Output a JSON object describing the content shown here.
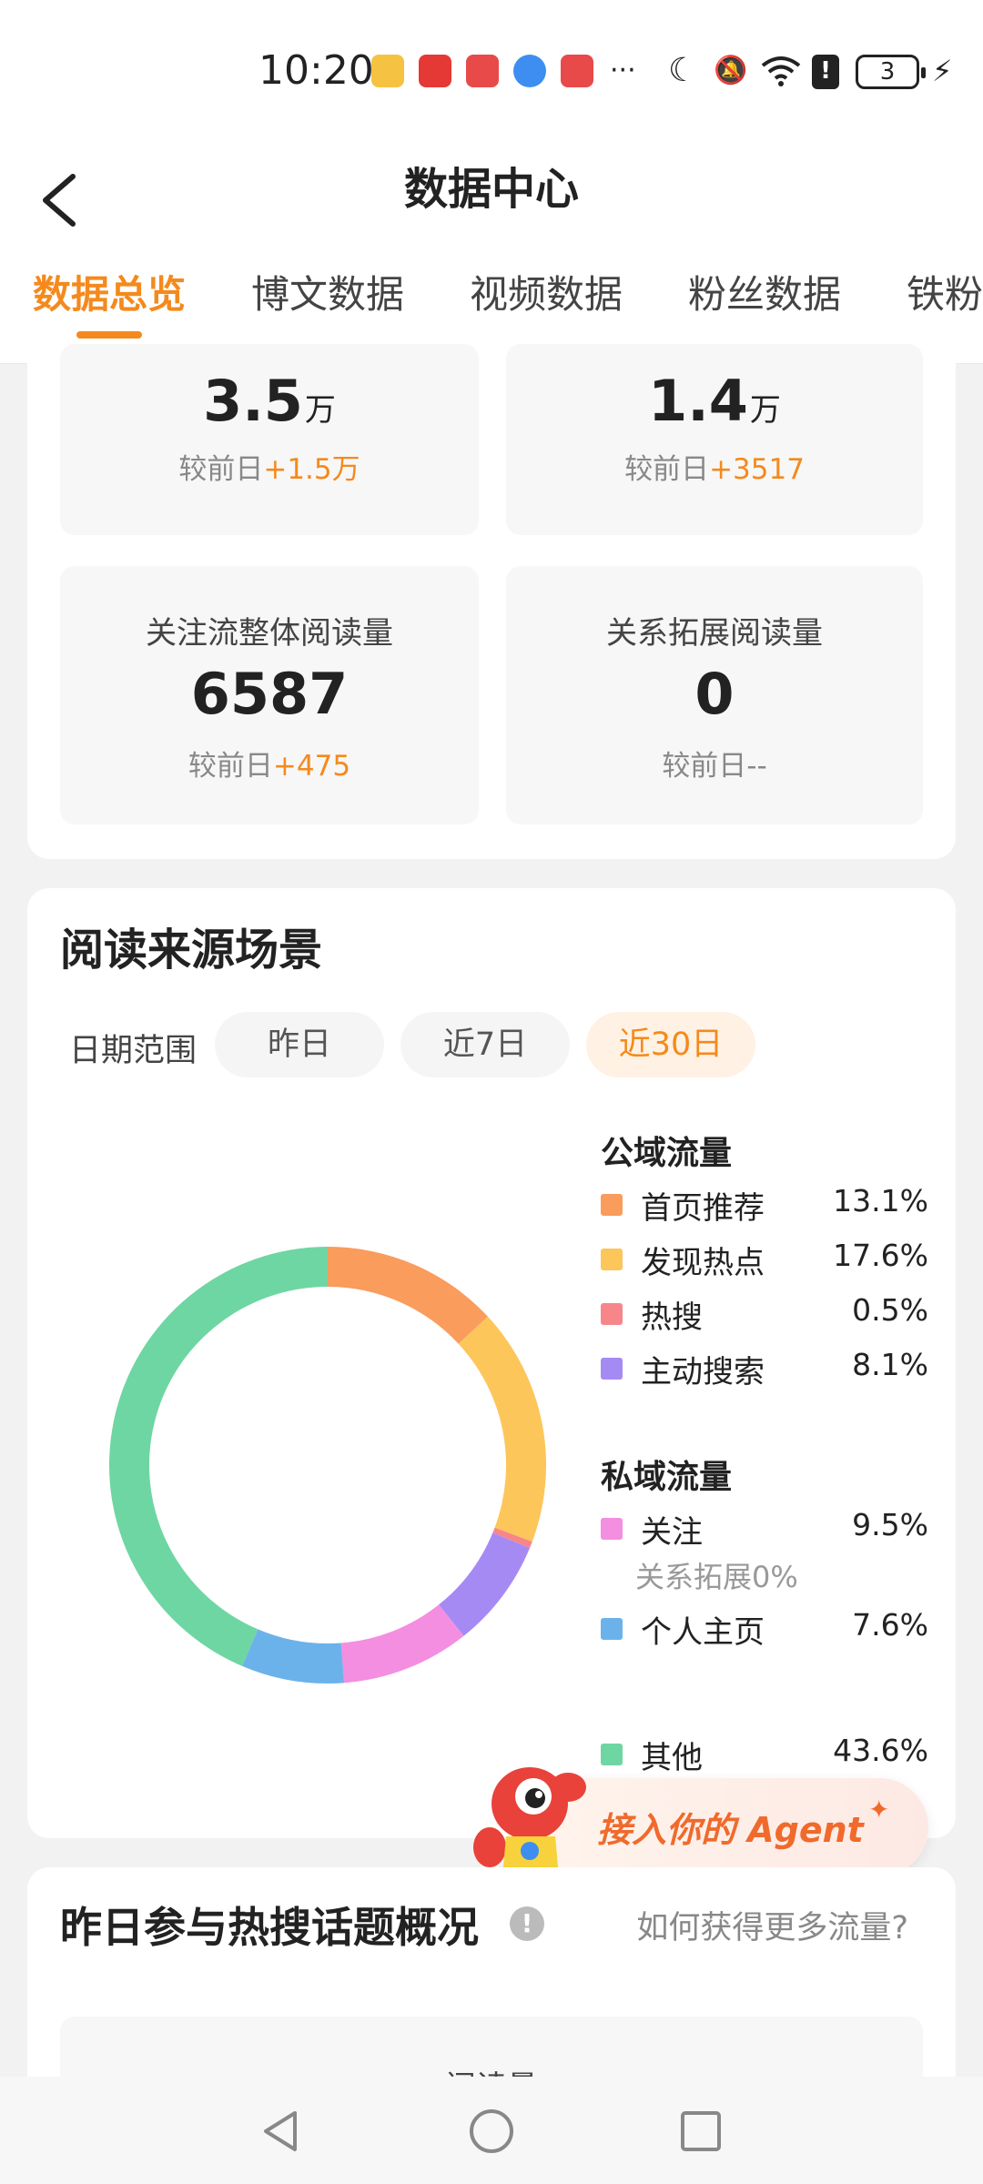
{
  "status_bar": {
    "time": "10:20",
    "battery": "3",
    "notification_apps": [
      "weibo-app-icon",
      "xiaohongshu-app-icon",
      "reader-app-icon",
      "browser-app-icon",
      "reader-app-icon"
    ],
    "more_indicator": "···"
  },
  "header": {
    "title": "数据中心",
    "tabs": [
      {
        "label": "数据总览",
        "active": true
      },
      {
        "label": "博文数据",
        "active": false
      },
      {
        "label": "视频数据",
        "active": false
      },
      {
        "label": "粉丝数据",
        "active": false
      },
      {
        "label": "铁粉",
        "active": false
      }
    ]
  },
  "overview": {
    "stats": [
      {
        "label": "",
        "value": "3.5",
        "unit": "万",
        "delta_prefix": "较前日",
        "delta": "+1.5万"
      },
      {
        "label": "",
        "value": "1.4",
        "unit": "万",
        "delta_prefix": "较前日",
        "delta": "+3517"
      },
      {
        "label": "关注流整体阅读量",
        "value": "6587",
        "unit": "",
        "delta_prefix": "较前日",
        "delta": "+475"
      },
      {
        "label": "关系拓展阅读量",
        "value": "0",
        "unit": "",
        "delta_prefix": "较前日",
        "delta": "--"
      }
    ]
  },
  "read_sources": {
    "title": "阅读来源场景",
    "date_range_label": "日期范围",
    "date_options": [
      {
        "label": "昨日",
        "active": false
      },
      {
        "label": "近7日",
        "active": false
      },
      {
        "label": "近30日",
        "active": true
      }
    ],
    "public_title": "公域流量",
    "private_title": "私域流量",
    "relation_note": "关系拓展0%",
    "legend": [
      {
        "name": "首页推荐",
        "pct": "13.1%",
        "color": "#f99c5c"
      },
      {
        "name": "发现热点",
        "pct": "17.6%",
        "color": "#fcc65a"
      },
      {
        "name": "热搜",
        "pct": "0.5%",
        "color": "#f7868a"
      },
      {
        "name": "主动搜索",
        "pct": "8.1%",
        "color": "#a68af4"
      },
      {
        "name": "关注",
        "pct": "9.5%",
        "color": "#f48ee0"
      },
      {
        "name": "个人主页",
        "pct": "7.6%",
        "color": "#6cb2ea"
      },
      {
        "name": "其他",
        "pct": "43.6%",
        "color": "#6ed6a2"
      }
    ]
  },
  "chart_data": {
    "type": "pie",
    "categories": [
      "首页推荐",
      "发现热点",
      "热搜",
      "主动搜索",
      "关注",
      "个人主页",
      "其他"
    ],
    "values": [
      13.1,
      17.6,
      0.5,
      8.1,
      9.5,
      7.6,
      43.6
    ],
    "colors": [
      "#f99c5c",
      "#fcc65a",
      "#f7868a",
      "#a68af4",
      "#f48ee0",
      "#6cb2ea",
      "#6ed6a2"
    ],
    "title": "",
    "legend_position": "right"
  },
  "agent_banner": {
    "text": "接入你的 Agent",
    "sparkle": "✦"
  },
  "hot_topics": {
    "title": "昨日参与热搜话题概况",
    "info_icon": "!",
    "more_link": "如何获得更多流量?",
    "box_label": "阅读量"
  },
  "colors": {
    "accent": "#f48a1d"
  }
}
